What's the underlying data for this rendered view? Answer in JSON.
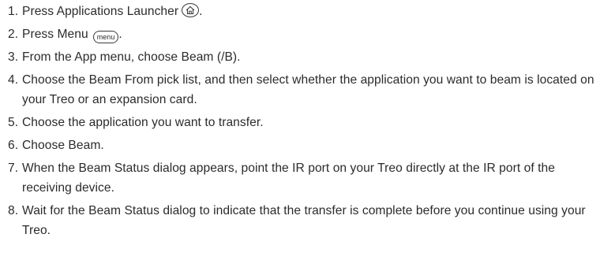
{
  "steps": [
    {
      "num": "1.",
      "text": "Press Applications Launcher",
      "icon": "home-key-icon",
      "after": "."
    },
    {
      "num": "2.",
      "text": "Press Menu",
      "icon": "menu-key-icon",
      "icon_label": "menu",
      "after": "."
    },
    {
      "num": "3.",
      "text": "From the App menu, choose Beam (/B)."
    },
    {
      "num": "4.",
      "text": "Choose the Beam From pick list, and then select whether the application you want to beam is located on your Treo or an expansion card."
    },
    {
      "num": "5.",
      "text": "Choose the application you want to transfer."
    },
    {
      "num": "6.",
      "text": "Choose Beam."
    },
    {
      "num": "7.",
      "text": "When the Beam Status dialog appears, point the IR port on your Treo directly at the IR port of the receiving device."
    },
    {
      "num": "8.",
      "text": "Wait for the Beam Status dialog to indicate that the transfer is complete before you continue using your Treo."
    }
  ]
}
